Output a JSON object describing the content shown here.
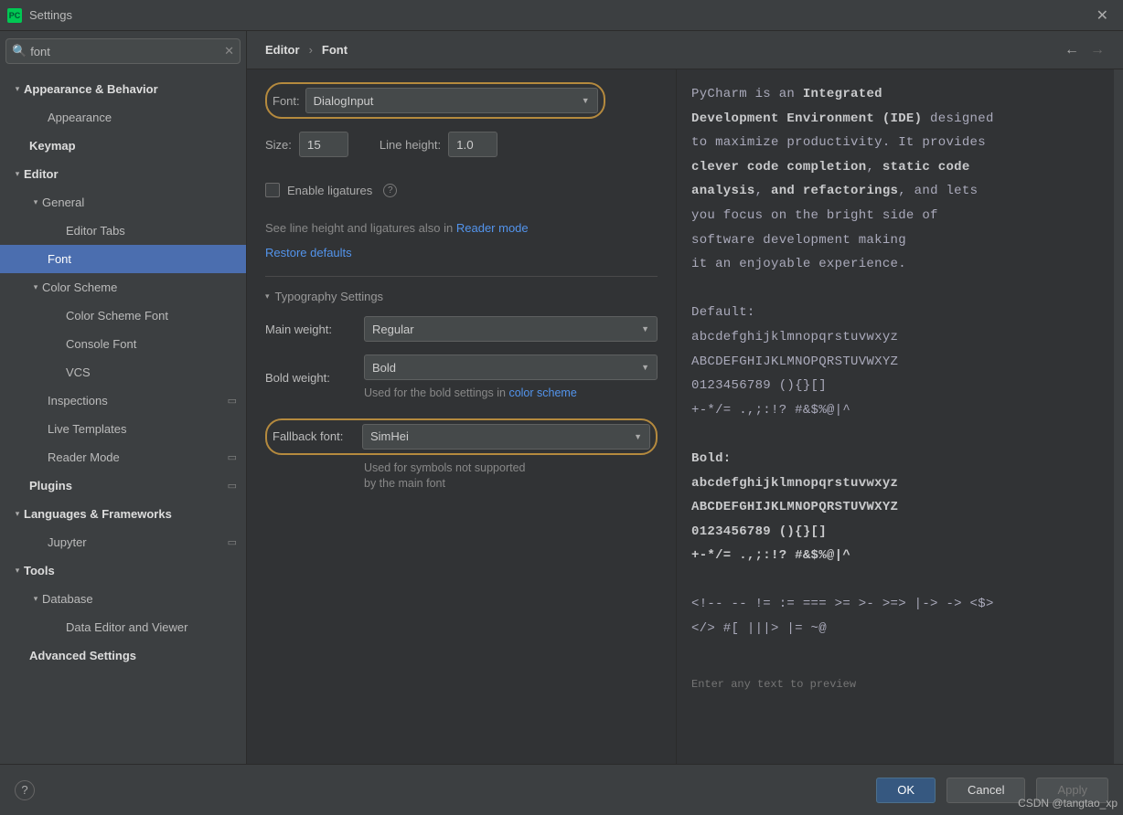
{
  "window": {
    "title": "Settings"
  },
  "search": {
    "value": "font"
  },
  "tree": {
    "appearance_behavior": "Appearance & Behavior",
    "appearance": "Appearance",
    "keymap": "Keymap",
    "editor": "Editor",
    "general": "General",
    "editor_tabs": "Editor Tabs",
    "font": "Font",
    "color_scheme": "Color Scheme",
    "color_scheme_font": "Color Scheme Font",
    "console_font": "Console Font",
    "vcs": "VCS",
    "inspections": "Inspections",
    "live_templates": "Live Templates",
    "reader_mode": "Reader Mode",
    "plugins": "Plugins",
    "languages_frameworks": "Languages & Frameworks",
    "jupyter": "Jupyter",
    "tools": "Tools",
    "database": "Database",
    "data_editor_viewer": "Data Editor and Viewer",
    "advanced_settings": "Advanced Settings"
  },
  "breadcrumb": {
    "a": "Editor",
    "b": "Font"
  },
  "form": {
    "font_label": "Font:",
    "font_value": "DialogInput",
    "size_label": "Size:",
    "size_value": "15",
    "lineheight_label": "Line height:",
    "lineheight_value": "1.0",
    "ligatures_label": "Enable ligatures",
    "reader_note_pre": "See line height and ligatures also in ",
    "reader_link": "Reader mode",
    "restore": "Restore defaults",
    "typography": "Typography Settings",
    "main_weight_label": "Main weight:",
    "main_weight_value": "Regular",
    "bold_weight_label": "Bold weight:",
    "bold_weight_value": "Bold",
    "bold_hint_pre": "Used for the bold settings in ",
    "bold_hint_link": "color scheme",
    "fallback_label": "Fallback font:",
    "fallback_value": "SimHei",
    "fallback_hint1": "Used for symbols not supported",
    "fallback_hint2": "by the main font"
  },
  "preview": {
    "l1a": "PyCharm is an ",
    "l1b": "Integrated",
    "l2a": "Development Environment (IDE)",
    "l2b": " designed",
    "l3": "to maximize productivity. It provides",
    "l4a": "clever code completion",
    "l4b": ", ",
    "l4c": "static code",
    "l5a": "analysis",
    "l5b": ", ",
    "l5c": "and refactorings",
    "l5d": ", and lets",
    "l6": "you focus on the bright side of",
    "l7": "software development making",
    "l8": "it an enjoyable experience.",
    "def": "Default:",
    "d1": "abcdefghijklmnopqrstuvwxyz",
    "d2": "ABCDEFGHIJKLMNOPQRSTUVWXYZ",
    "d3": " 0123456789 (){}[]",
    "d4": " +-*/= .,;:!? #&$%@|^",
    "bold": "Bold:",
    "b1": "abcdefghijklmnopqrstuvwxyz",
    "b2": "ABCDEFGHIJKLMNOPQRSTUVWXYZ",
    "b3": " 0123456789 (){}[]",
    "b4": " +-*/= .,;:!? #&$%@|^",
    "s1": "<!-- -- != := === >= >- >=> |-> -> <$>",
    "s2": "</> #[ |||> |= ~@",
    "placeholder": "Enter any text to preview"
  },
  "footer": {
    "ok": "OK",
    "cancel": "Cancel",
    "apply": "Apply"
  },
  "watermark": "CSDN @tangtao_xp"
}
